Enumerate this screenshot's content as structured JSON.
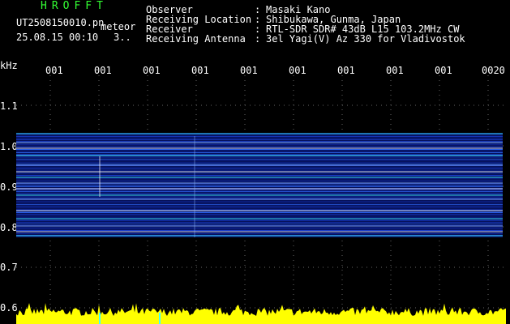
{
  "header": {
    "title_letters": "HROFFT",
    "filename": "UT2508150010.pn",
    "mode": "meteor",
    "datetime": "25.08.15 00:10",
    "count": "3..",
    "info": [
      {
        "key": "Observer",
        "sep": ":",
        "value": "Masaki Kano"
      },
      {
        "key": "Receiving Location",
        "sep": ":",
        "value": "Shibukawa, Gunma, Japan"
      },
      {
        "key": "Receiver",
        "sep": ":",
        "value": "RTL-SDR SDR# 43dB L15 103.2MHz CW"
      },
      {
        "key": "Receiving Antenna",
        "sep": ":",
        "value": "3el Yagi(V) Az 330 for Vladivostok"
      }
    ]
  },
  "axis": {
    "unit": "kHz",
    "time_ticks": [
      "001",
      "001",
      "001",
      "001",
      "001",
      "001",
      "001",
      "001",
      "001",
      "0020"
    ],
    "freq_ticks": [
      "1.1",
      "1.0",
      "0.9",
      "0.8",
      "0.7",
      "0.6"
    ]
  },
  "colors": {
    "background": "#000000",
    "header_green": "#33ff33",
    "noise_band": "#1a3fd0",
    "line_cyan": "#40ffff",
    "line_yellow": "#ffff00",
    "grid_dot": "#666666"
  }
}
